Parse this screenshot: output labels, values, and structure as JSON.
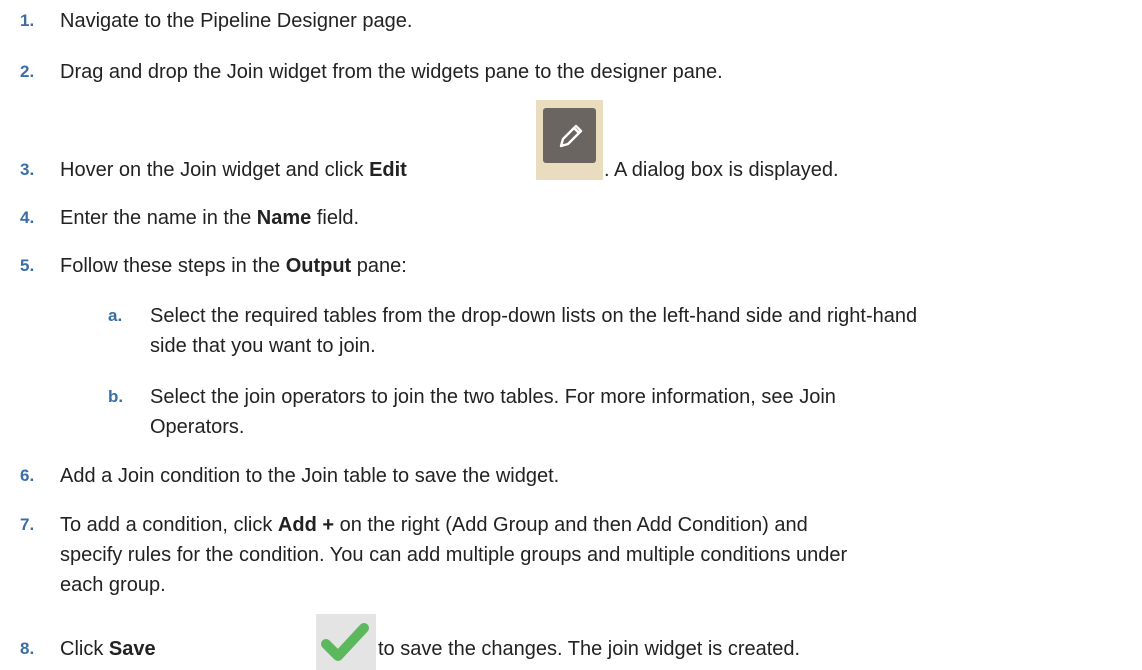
{
  "steps": [
    {
      "num": "1.",
      "text": "Navigate to the Pipeline Designer page."
    },
    {
      "num": "2.",
      "text": "Drag and drop the Join widget from the widgets pane to the designer pane."
    },
    {
      "num": "3.",
      "pre": "Hover on the Join widget and click ",
      "bold": "Edit",
      "post": ". A dialog box is displayed.",
      "icon": "pencil-icon"
    },
    {
      "num": "4.",
      "pre": "Enter the name in the ",
      "bold": "Name",
      "post": " field."
    },
    {
      "num": "5.",
      "pre": "Follow these steps in the ",
      "bold": "Output",
      "post": " pane:"
    },
    {
      "num": "6.",
      "text": "Add a Join condition to the Join table to save the widget."
    },
    {
      "num": "7.",
      "pre": "To add a condition, click ",
      "bold": "Add +",
      "line1_post": " on the right (Add Group and then Add Condition) and",
      "line2": "specify rules for the condition. You can add multiple groups and multiple conditions under",
      "line3": "each group."
    },
    {
      "num": "8.",
      "pre": "Click ",
      "bold": "Save",
      "post": " to save the changes. The join widget is created.",
      "icon": "checkmark-icon"
    }
  ],
  "substeps": [
    {
      "num": "a.",
      "line1": "Select the required tables from the drop-down lists on the left-hand side and right-hand",
      "line2": "side that you want to join."
    },
    {
      "num": "b.",
      "line1": "Select the join operators to join the two tables. For more information, see Join",
      "line2": "Operators."
    }
  ],
  "colors": {
    "number": "#3a6ea5",
    "text": "#222222",
    "edit_icon_bg": "#6b6561",
    "edit_icon_frame": "#e9dcbf",
    "check_green": "#5cb85c"
  }
}
